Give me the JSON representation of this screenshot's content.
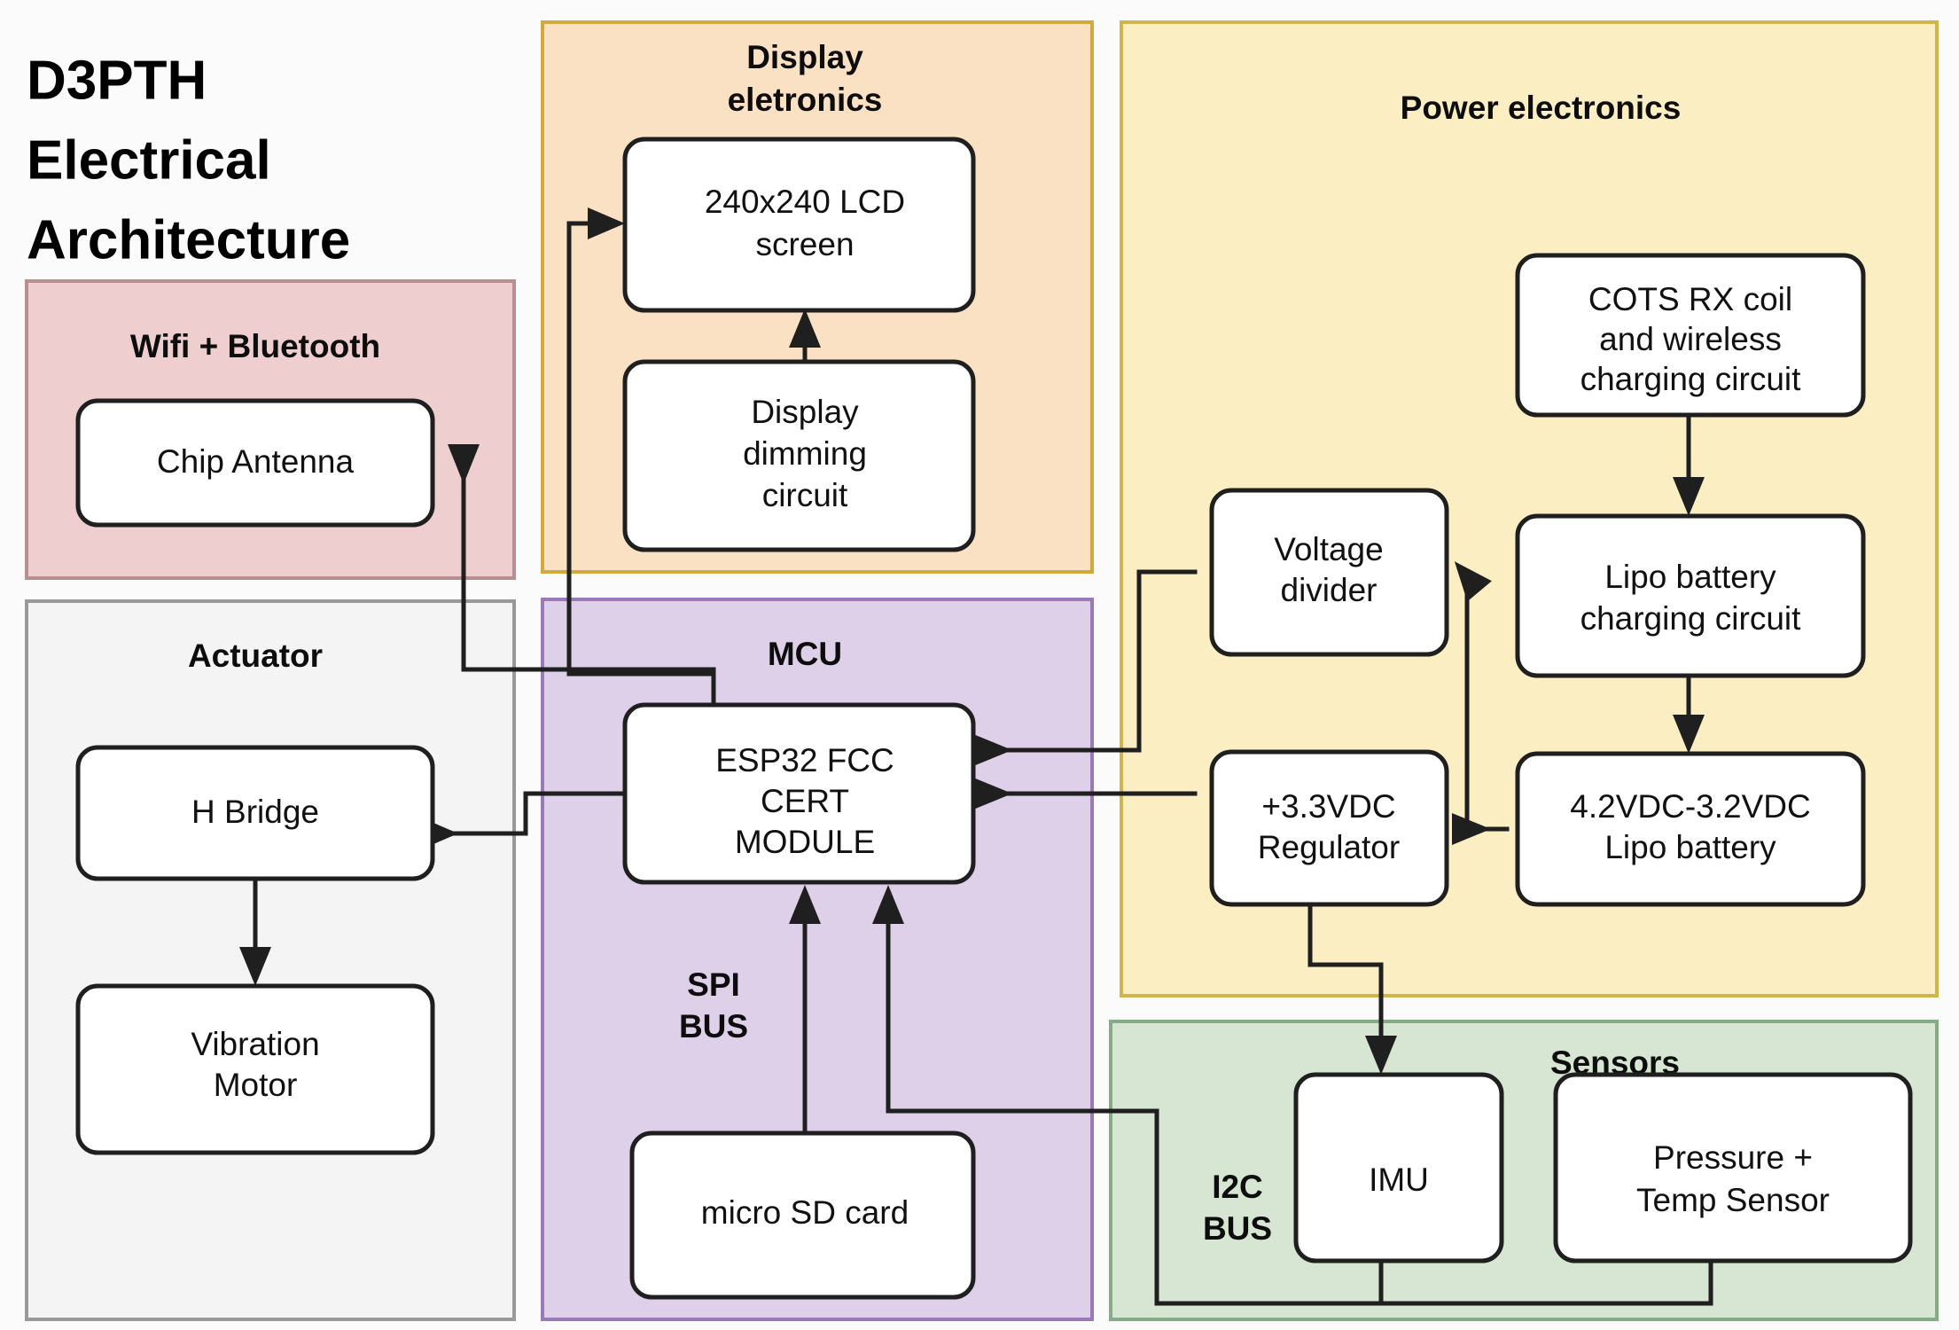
{
  "page": {
    "title_lines": [
      "D3PTH",
      "Electrical",
      "Architecture"
    ],
    "background_color": "#fbfbfb"
  },
  "groups": {
    "wifi": {
      "title": "Wifi + Bluetooth",
      "fill": "#eecece",
      "stroke": "#b98e8e"
    },
    "actuator": {
      "title": "Actuator",
      "fill": "#f4f4f4",
      "stroke": "#999999"
    },
    "display": {
      "title_line1": "Display",
      "title_line2": "eletronics",
      "fill": "#fae1c3",
      "stroke": "#d2a93f"
    },
    "mcu": {
      "title": "MCU",
      "bus_label_line1": "SPI",
      "bus_label_line2": "BUS",
      "fill": "#ded0e8",
      "stroke": "#9a79b8"
    },
    "power": {
      "title": "Power electronics",
      "fill": "#faeec2",
      "stroke": "#cfb54b"
    },
    "sensors": {
      "title": "Sensors",
      "bus_label_line1": "I2C",
      "bus_label_line2": "BUS",
      "fill": "#d6e6d2",
      "stroke": "#86ac86"
    }
  },
  "nodes": {
    "chip_antenna": {
      "label": "Chip Antenna"
    },
    "h_bridge": {
      "label": "H Bridge"
    },
    "vibration_motor": {
      "label_line1": "Vibration",
      "label_line2": "Motor"
    },
    "lcd_screen": {
      "label_line1": "240x240 LCD",
      "label_line2": "screen"
    },
    "display_dimming": {
      "label_line1": "Display",
      "label_line2": "dimming",
      "label_line3": "circuit"
    },
    "esp32": {
      "label_line1": "ESP32 FCC",
      "label_line2": "CERT",
      "label_line3": "MODULE"
    },
    "micro_sd": {
      "label": "micro SD card"
    },
    "cots_rx_coil": {
      "label_line1": "COTS RX coil",
      "label_line2": "and wireless",
      "label_line3": "charging circuit"
    },
    "lipo_charging": {
      "label_line1": "Lipo battery",
      "label_line2": "charging circuit"
    },
    "lipo_battery": {
      "label_line1": "4.2VDC-3.2VDC",
      "label_line2": "Lipo battery"
    },
    "voltage_divider": {
      "label_line1": "Voltage",
      "label_line2": "divider"
    },
    "regulator": {
      "label_line1": "+3.3VDC",
      "label_line2": "Regulator"
    },
    "imu": {
      "label": "IMU"
    },
    "pressure_temp": {
      "label_line1": "Pressure +",
      "label_line2": "Temp Sensor"
    }
  },
  "colors": {
    "node_fill": "#ffffff",
    "node_stroke": "#1f1f1f",
    "edge_stroke": "#1f1f1f",
    "text": "#111111"
  }
}
